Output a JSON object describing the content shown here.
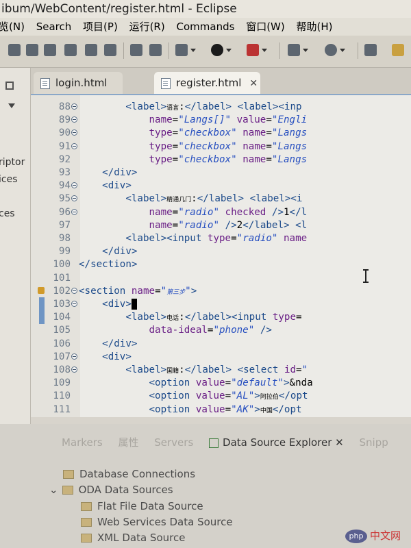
{
  "window": {
    "title": "ibum/WebContent/register.html  -  Eclipse"
  },
  "menu": [
    "览(N)",
    "Search",
    "项目(P)",
    "运行(R)",
    "Commands",
    "窗口(W)",
    "帮助(H)"
  ],
  "left_panel": [
    "riptor",
    "ices",
    "ces"
  ],
  "tabs": [
    {
      "label": "login.html"
    },
    {
      "label": "register.html"
    }
  ],
  "editor": {
    "lines": [
      {
        "n": "88",
        "fold": true,
        "html": "        <span class='tag'>&lt;label&gt;</span><span class='cjk'>语言</span>:<span class='tag'>&lt;/label&gt;</span> <span class='tag'>&lt;label&gt;&lt;inp</span>"
      },
      {
        "n": "89",
        "fold": true,
        "html": "            <span class='at'>name</span>=<span class='st'>\"Langs[]\"</span> <span class='at'>value</span>=<span class='st'>\"Engli</span>"
      },
      {
        "n": "90",
        "fold": true,
        "html": "            <span class='at'>type</span>=<span class='st'>\"checkbox\"</span> <span class='at'>name</span>=<span class='st'>\"Langs</span>"
      },
      {
        "n": "91",
        "fold": true,
        "html": "            <span class='at'>type</span>=<span class='st'>\"checkbox\"</span> <span class='at'>name</span>=<span class='st'>\"Langs</span>"
      },
      {
        "n": "92",
        "fold": false,
        "html": "            <span class='at'>type</span>=<span class='st'>\"checkbox\"</span> <span class='at'>name</span>=<span class='st'>\"Langs</span>"
      },
      {
        "n": "93",
        "fold": false,
        "html": "    <span class='tag'>&lt;/div&gt;</span>"
      },
      {
        "n": "94",
        "fold": true,
        "html": "    <span class='tag'>&lt;div&gt;</span>"
      },
      {
        "n": "95",
        "fold": true,
        "html": "        <span class='tag'>&lt;label&gt;</span><span class='cjk'>精通几门</span>:<span class='tag'>&lt;/label&gt;</span> <span class='tag'>&lt;label&gt;&lt;i</span>"
      },
      {
        "n": "96",
        "fold": true,
        "html": "            <span class='at'>name</span>=<span class='st'>\"radio\"</span> <span class='at'>checked</span> <span class='tag'>/&gt;</span>1<span class='tag'>&lt;/l</span>"
      },
      {
        "n": "97",
        "fold": false,
        "html": "            <span class='at'>name</span>=<span class='st'>\"radio\"</span> <span class='tag'>/&gt;</span>2<span class='tag'>&lt;/label&gt;</span> <span class='tag'>&lt;l</span>"
      },
      {
        "n": "98",
        "fold": false,
        "html": "        <span class='tag'>&lt;label&gt;&lt;input</span> <span class='at'>type</span>=<span class='st'>\"radio\"</span> <span class='at'>name</span>"
      },
      {
        "n": "99",
        "fold": false,
        "html": "    <span class='tag'>&lt;/div&gt;</span>"
      },
      {
        "n": "100",
        "fold": false,
        "html": "<span class='tag'>&lt;/section&gt;</span>"
      },
      {
        "n": "101",
        "fold": false,
        "html": ""
      },
      {
        "n": "102",
        "fold": true,
        "lock": true,
        "html": "<span class='tag'>&lt;section</span> <span class='at'>name</span>=<span class='st'>\"<span class='cjk'>第三步</span>\"</span><span class='tag'>&gt;</span>"
      },
      {
        "n": "103",
        "fold": true,
        "marker": true,
        "html": "    <span class='tag'>&lt;div&gt;</span><span class='cursor'></span>"
      },
      {
        "n": "104",
        "fold": false,
        "marker": true,
        "html": "        <span class='tag'>&lt;label&gt;</span><span class='cjk'>电话</span>:<span class='tag'>&lt;/label&gt;&lt;input</span> <span class='at'>type</span>="
      },
      {
        "n": "105",
        "fold": false,
        "html": "            <span class='at'>data-ideal</span>=<span class='st'>\"phone\"</span> <span class='tag'>/&gt;</span>"
      },
      {
        "n": "106",
        "fold": false,
        "html": "    <span class='tag'>&lt;/div&gt;</span>"
      },
      {
        "n": "107",
        "fold": true,
        "html": "    <span class='tag'>&lt;div&gt;</span>"
      },
      {
        "n": "108",
        "fold": true,
        "html": "        <span class='tag'>&lt;label&gt;</span><span class='cjk'>国籍</span>:<span class='tag'>&lt;/label&gt;</span> <span class='tag'>&lt;select</span> <span class='at'>id</span>=<span class='st'>\"</span>"
      },
      {
        "n": "109",
        "fold": false,
        "html": "            <span class='tag'>&lt;option</span> <span class='at'>value</span>=<span class='st'>\"default\"</span><span class='tag'>&gt;</span>&amp;nda"
      },
      {
        "n": "110",
        "fold": false,
        "html": "            <span class='tag'>&lt;option</span> <span class='at'>value</span>=<span class='st'>\"AL\"</span><span class='tag'>&gt;</span><span class='cjk'>阿拉伯</span><span class='tag'>&lt;/opt</span>"
      },
      {
        "n": "111",
        "fold": false,
        "html": "            <span class='tag'>&lt;option</span> <span class='at'>value</span>=<span class='st'>\"AK\"</span><span class='tag'>&gt;</span><span class='cjk'>中国</span><span class='tag'>&lt;/opt</span>"
      }
    ]
  },
  "bottom": {
    "tabs": [
      {
        "label": "Markers"
      },
      {
        "label": "属性"
      },
      {
        "label": "Servers"
      },
      {
        "label": "Data Source Explorer"
      },
      {
        "label": "Snipp"
      }
    ],
    "tree": [
      "Database Connections",
      "ODA Data Sources",
      "Flat File Data Source",
      "Web Services Data Source",
      "XML Data Source"
    ]
  },
  "watermark": {
    "text": "中文网",
    "logo": "php"
  },
  "icons": {
    "close": "close-icon",
    "file": "html-file-icon",
    "fold": "fold-minus-icon",
    "cursor": "ibeam-cursor-icon"
  }
}
